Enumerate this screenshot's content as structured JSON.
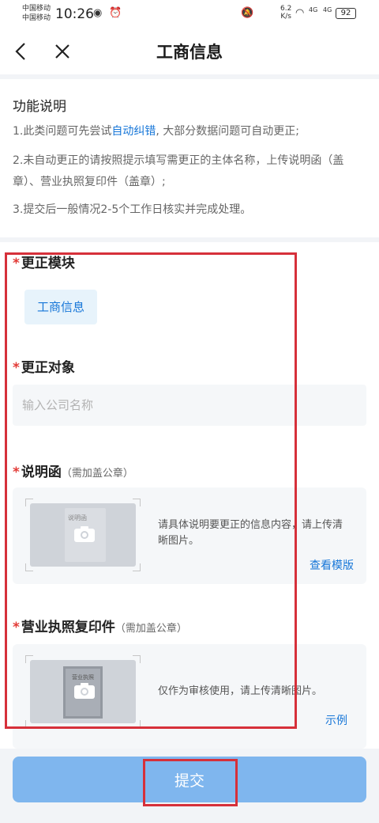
{
  "status_bar": {
    "carrier_1": "中国移动",
    "carrier_2": "中国移动",
    "time": "10:26",
    "speed_value": "6.2",
    "speed_unit": "K/s",
    "net_1": "4G",
    "net_2": "4G",
    "battery": "92"
  },
  "nav": {
    "title": "工商信息"
  },
  "intro": {
    "title": "功能说明",
    "line1_prefix": "1.此类问题可先尝试",
    "line1_link": "自动纠错",
    "line1_suffix": ", 大部分数据问题可自动更正;",
    "line2": "2.未自动更正的请按照提示填写需更正的主体名称，上传说明函（盖章）、营业执照复印件（盖章）;",
    "line3": "3.提交后一般情况2-5个工作日核实并完成处理。"
  },
  "form": {
    "required_mark": "*",
    "module_label": "更正模块",
    "module_chip": "工商信息",
    "target_label": "更正对象",
    "target_placeholder": "输入公司名称",
    "letter_label": "说明函",
    "letter_sub": "（需加盖公章）",
    "letter_thumb_text": "说明函",
    "letter_hint": "请具体说明要更正的信息内容，请上传清晰图片。",
    "letter_link": "查看模版",
    "license_label": "营业执照复印件",
    "license_sub": "（需加盖公章）",
    "license_thumb_text": "营业执照",
    "license_hint": "仅作为审核使用，请上传清晰图片。",
    "license_link": "示例"
  },
  "submit": {
    "label": "提交"
  },
  "colors": {
    "accent": "#1676d8",
    "highlight": "#d6303a",
    "submit_bg": "#7fb6ee"
  }
}
